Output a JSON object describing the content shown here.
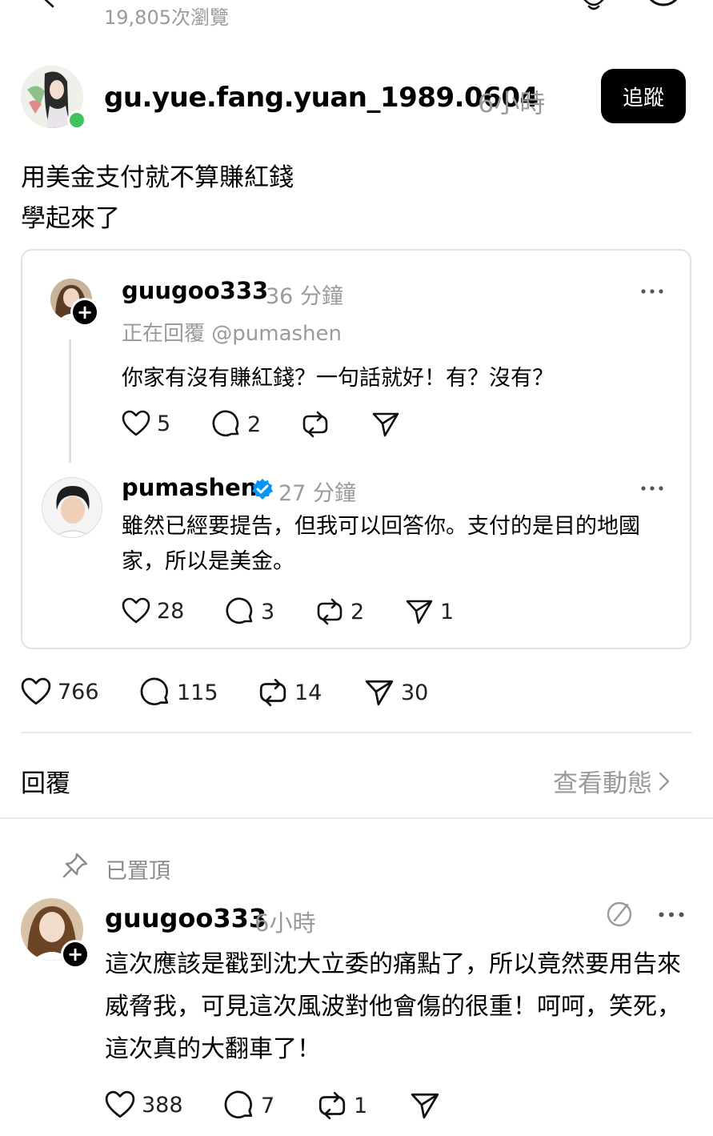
{
  "header": {
    "views": "19,805次瀏覽"
  },
  "post": {
    "author": "gu.yue.fang.yuan_1989.0604",
    "time": "6小時",
    "follow_label": "追蹤",
    "text": "用美金支付就不算賺紅錢\n學起來了",
    "likes": "766",
    "comments": "115",
    "reposts": "14",
    "shares": "30"
  },
  "quote": {
    "first": {
      "author": "guugoo333",
      "time": "36 分鐘",
      "replying_to": "正在回覆 @pumashen",
      "text": "你家有沒有賺紅錢？一句話就好！有？沒有？",
      "likes": "5",
      "comments": "2"
    },
    "second": {
      "author": "pumashen",
      "time": "27 分鐘",
      "text": "雖然已經要提告，但我可以回答你。支付的是目的地國家，所以是美金。",
      "likes": "28",
      "comments": "3",
      "reposts": "2",
      "shares": "1"
    }
  },
  "replies": {
    "label": "回覆",
    "activity_link": "查看動態",
    "pinned_label": "已置頂",
    "comment": {
      "author": "guugoo333",
      "time": "6小時",
      "text": "這次應該是戳到沈大立委的痛點了，所以竟然要用告來威脅我，可見這次風波對他會傷的很重！呵呵，笑死，這次真的大翻車了！",
      "likes": "388",
      "comments": "7",
      "reposts": "1"
    }
  },
  "colors": {
    "accent_online": "#3ec35b",
    "verified": "#0095f6",
    "muted": "#999999"
  }
}
